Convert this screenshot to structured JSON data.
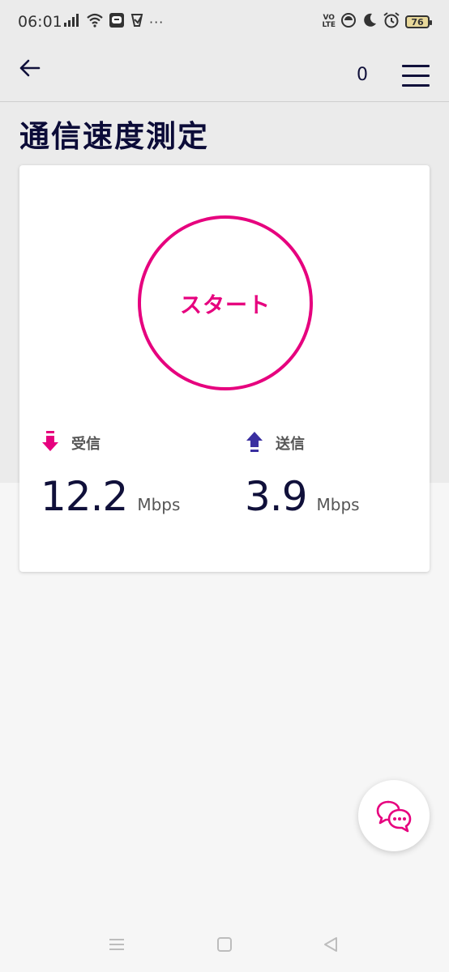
{
  "status_bar": {
    "time": "06:01",
    "volte": [
      "VO",
      "LTE"
    ],
    "battery": "76",
    "more_dots": "···"
  },
  "header": {
    "cart_count": "0"
  },
  "page": {
    "title": "通信速度測定"
  },
  "speed_test": {
    "start_label": "スタート",
    "download": {
      "label": "受信",
      "value": "12.2",
      "unit": "Mbps"
    },
    "upload": {
      "label": "送信",
      "value": "3.9",
      "unit": "Mbps"
    }
  },
  "colors": {
    "accent": "#e6007e",
    "navy": "#10103a",
    "upload_arrow": "#3a2fa0"
  }
}
